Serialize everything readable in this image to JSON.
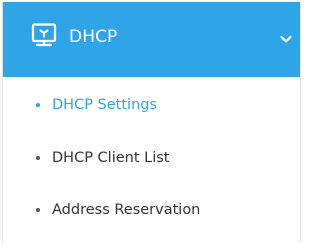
{
  "menu": {
    "title": "DHCP",
    "icon": "monitor-network-icon",
    "expand_icon": "chevron-down-icon",
    "expanded": true,
    "items": [
      {
        "label": "DHCP Settings",
        "active": true
      },
      {
        "label": "DHCP Client List",
        "active": false
      },
      {
        "label": "Address Reservation",
        "active": false
      }
    ]
  },
  "colors": {
    "accent": "#2fa4e7",
    "header_text": "#ffffff",
    "item_text": "#333333",
    "border": "#e1e1e1"
  }
}
